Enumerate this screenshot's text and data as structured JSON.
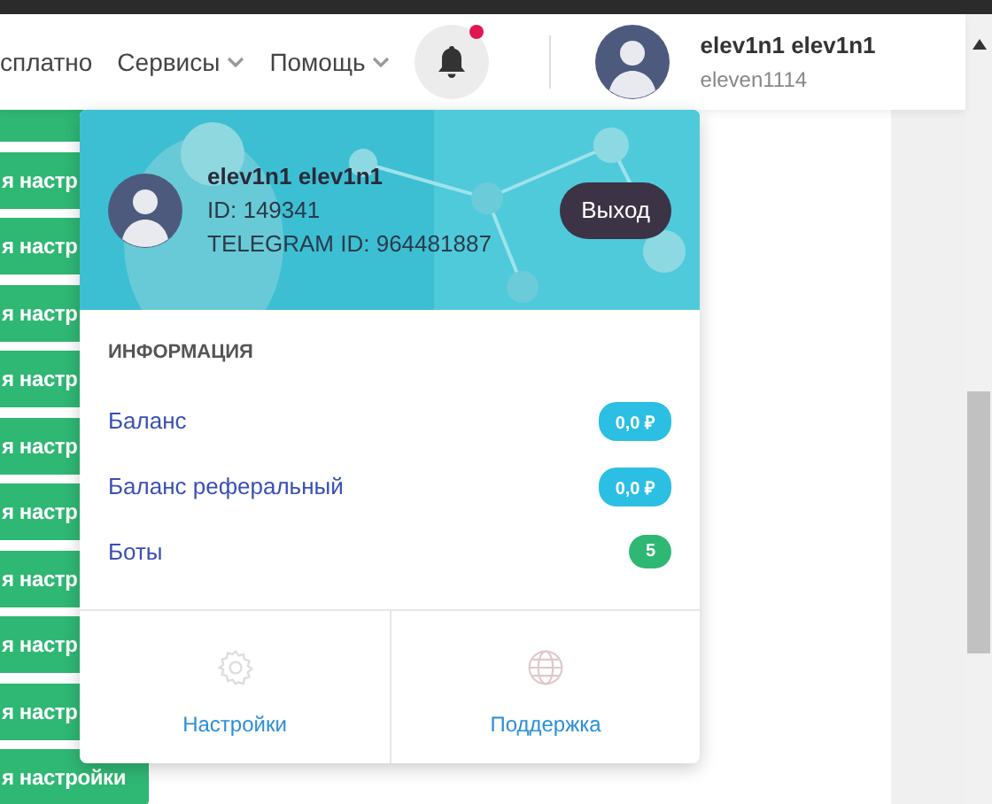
{
  "nav": {
    "items": [
      {
        "label": "сплатно",
        "dropdown": false
      },
      {
        "label": "Сервисы",
        "dropdown": true
      },
      {
        "label": "Помощь",
        "dropdown": true
      }
    ]
  },
  "notifications": {
    "unread": true
  },
  "user": {
    "name": "elev1n1 elev1n1",
    "login": "eleven1114"
  },
  "side_buttons": [
    "я настр",
    "я настр",
    "я настр",
    "я настр",
    "я настр",
    "я настр",
    "я настр",
    "я настр",
    "я настр",
    "я настройки"
  ],
  "menu": {
    "name": "elev1n1 elev1n1",
    "id": "ID: 149341",
    "telegram": "TELEGRAM ID: 964481887",
    "logout": "Выход",
    "section_title": "ИНФОРМАЦИЯ",
    "stats": [
      {
        "label": "Баланс",
        "value": "0,0 ₽",
        "color": "#2bbfe3"
      },
      {
        "label": "Баланс реферальный",
        "value": "0,0 ₽",
        "color": "#2bbfe3"
      },
      {
        "label": "Боты",
        "value": "5",
        "color": "#2fb774"
      }
    ],
    "actions": [
      {
        "label": "Настройки"
      },
      {
        "label": "Поддержка"
      }
    ]
  }
}
